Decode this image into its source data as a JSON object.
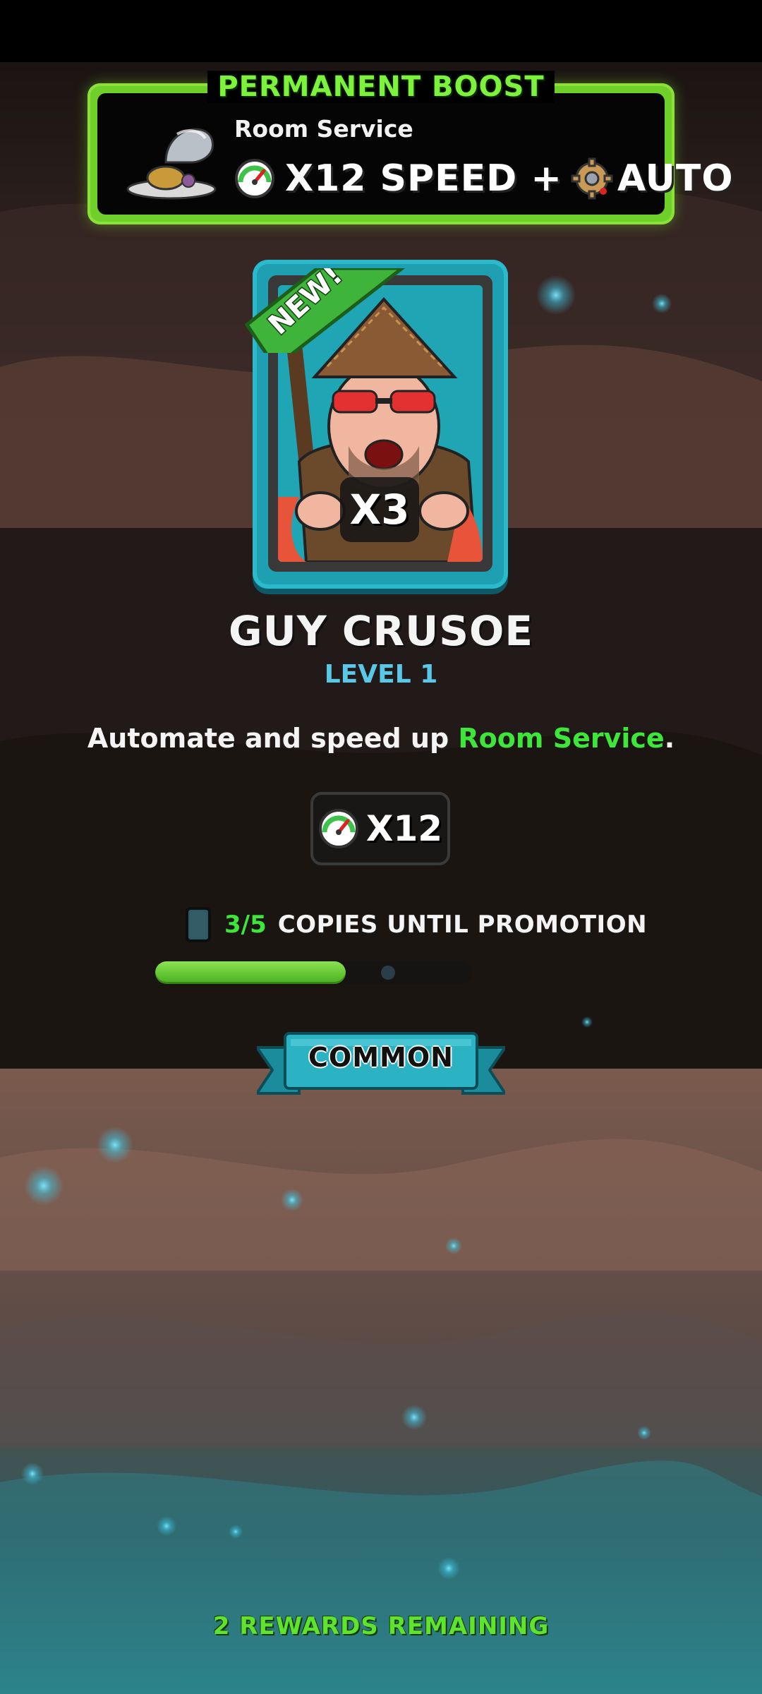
{
  "boost": {
    "title": "PERMANENT BOOST",
    "name": "Room Service",
    "multiplier": "X12 SPEED +",
    "auto": "AUTO"
  },
  "card": {
    "badge": "NEW!",
    "count": "X3",
    "name": "GUY CRUSOE",
    "level": "LEVEL 1"
  },
  "description": {
    "prefix": "Automate and speed up ",
    "highlight": "Room Service",
    "suffix": "."
  },
  "speed": {
    "value": "X12"
  },
  "promotion": {
    "count": "3/5",
    "label": "COPIES UNTIL PROMOTION",
    "progress": 0.6
  },
  "rarity": "COMMON",
  "rewards_remaining": "2 REWARDS REMAINING",
  "colors": {
    "accent_green": "#3ee63a",
    "level_blue": "#58c7e8",
    "card_teal": "#1f9fb2"
  },
  "icons": [
    "room-service-dish-icon",
    "speedometer-icon",
    "gear-auto-icon",
    "card-icon"
  ]
}
